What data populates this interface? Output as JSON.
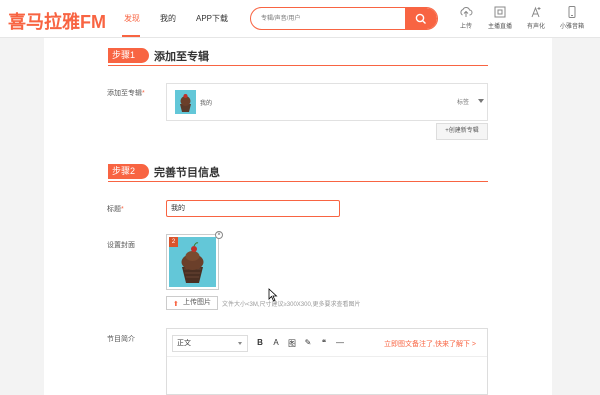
{
  "header": {
    "logo": "喜马拉雅FM",
    "nav": [
      "发现",
      "我的",
      "APP下载"
    ],
    "search_placeholder": "专辑/声音/用户",
    "tools": [
      {
        "icon": "upload-icon",
        "label": "上传"
      },
      {
        "icon": "live-icon",
        "label": "主播直播"
      },
      {
        "icon": "audio-icon",
        "label": "有声化"
      },
      {
        "icon": "phone-icon",
        "label": "小雅音箱"
      }
    ],
    "accent_color": "#f86442"
  },
  "step1": {
    "badge": "步骤1",
    "title": "添加至专辑",
    "field_label": "添加至专辑",
    "required_mark": "*",
    "album_name": "我的",
    "album_tag": "标签",
    "new_album_label": "+创建新专辑"
  },
  "step2": {
    "badge": "步骤2",
    "title": "完善节目信息",
    "title_label": "标题",
    "title_value": "我的",
    "cover_label": "设置封面",
    "cover_badge": "2",
    "upload_label": "上传图片",
    "upload_hint": "文件大小<3M,尺寸建议≥300X300,更多要求查看图片",
    "intro_label": "节目简介",
    "editor": {
      "format": "正文",
      "tools": [
        "B",
        "A",
        "图",
        "✎",
        "❝",
        "—"
      ],
      "link": "立即图文备注了,快来了解下 >"
    }
  }
}
